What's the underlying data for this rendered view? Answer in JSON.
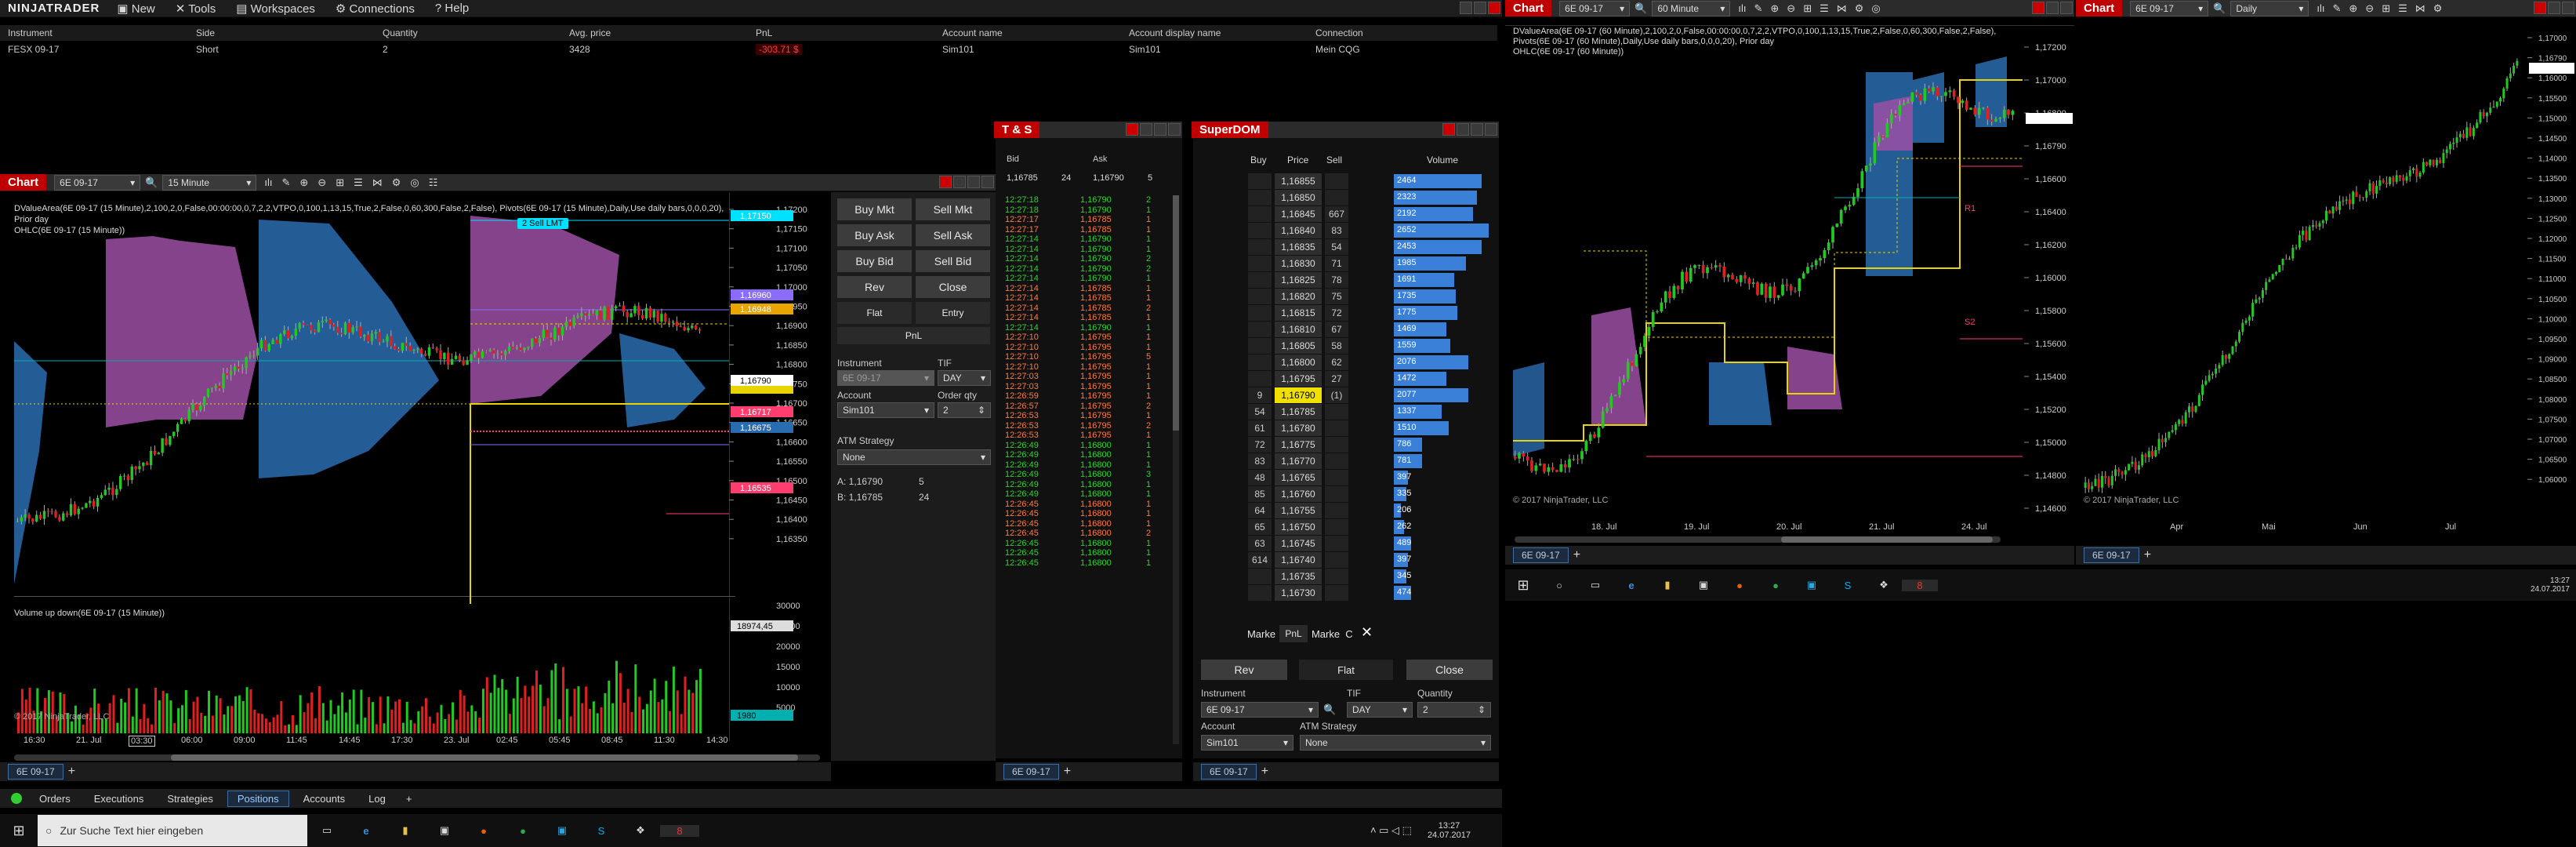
{
  "app": {
    "logo": "NINJATRADER",
    "menu": [
      "New",
      "Tools",
      "Workspaces",
      "Connections",
      "Help"
    ]
  },
  "positions": {
    "headers": [
      "Instrument",
      "Side",
      "Quantity",
      "Avg. price",
      "PnL",
      "Account name",
      "Account display name",
      "Connection"
    ],
    "row": [
      "FESX 09-17",
      "Short",
      "2",
      "3428",
      "-303.71 $",
      "Sim101",
      "Sim101",
      "Mein CQG"
    ]
  },
  "chart1": {
    "title": "Chart",
    "instrument": "6E 09-17",
    "interval": "15 Minute",
    "desc1": "DValueArea(6E 09-17 (15 Minute),2,100,2,0,False,00:00:00,0,7,2,2,VTPO,0,100,1,13,15,True,2,False,0,60,300,False,2,False), Pivots(6E 09-17 (15 Minute),Daily,Use daily bars,0,0,0,20), Prior day",
    "desc2": "OHLC(6E 09-17 (15 Minute))",
    "order_label": "2 Sell LMT",
    "price_tags": [
      "1,17150",
      "1,16960",
      "1,16948",
      "1,16790",
      "1,16717",
      "1,16675",
      "1,16535"
    ],
    "ticks": [
      "1,17200",
      "1,17150",
      "1,17100",
      "1,17050",
      "1,17000",
      "1,16950",
      "1,16900",
      "1,16850",
      "1,16800",
      "1,16750",
      "1,16700",
      "1,16650",
      "1,16600",
      "1,16550",
      "1,16500",
      "1,16450",
      "1,16400",
      "1,16350"
    ],
    "volume_title": "Volume up down(6E 09-17 (15 Minute))",
    "vol_ticks": [
      "30000",
      "25000",
      "20000",
      "15000",
      "10000",
      "5000"
    ],
    "vol_tags": [
      "18974,45",
      "1980"
    ],
    "copyright": "© 2017 NinjaTrader, LLC",
    "x_labels": [
      "16:30",
      "21. Jul",
      "03:30",
      "06:00",
      "09:00",
      "11:45",
      "14:45",
      "17:30",
      "23. Jul",
      "02:45",
      "05:45",
      "08:45",
      "11:30",
      "14:30"
    ],
    "tab": "6E 09-17"
  },
  "order_panel": {
    "buy_mkt": "Buy Mkt",
    "sell_mkt": "Sell Mkt",
    "buy_ask": "Buy Ask",
    "sell_ask": "Sell Ask",
    "buy_bid": "Buy Bid",
    "sell_bid": "Sell Bid",
    "rev": "Rev",
    "close": "Close",
    "flat": "Flat",
    "entry": "Entry",
    "pnl": "PnL",
    "instrument_label": "Instrument",
    "instrument": "6E 09-17",
    "tif_label": "TIF",
    "tif": "DAY",
    "account_label": "Account",
    "account": "Sim101",
    "qty_label": "Order qty",
    "qty": "2",
    "atm_label": "ATM Strategy",
    "atm": "None",
    "ask_line": "A: 1,16790",
    "ask_size": "5",
    "bid_line": "B: 1,16785",
    "bid_size": "24"
  },
  "ts": {
    "title": "T & S",
    "bid_label": "Bid",
    "ask_label": "Ask",
    "bid": "1,16785",
    "bid_size": "24",
    "ask": "1,16790",
    "ask_size": "5",
    "tab": "6E 09-17",
    "rows": [
      [
        "12:27:18",
        "1,16790",
        "2",
        "g"
      ],
      [
        "12:27:18",
        "1,16790",
        "1",
        "g"
      ],
      [
        "12:27:17",
        "1,16785",
        "1",
        "o"
      ],
      [
        "12:27:17",
        "1,16785",
        "1",
        "o"
      ],
      [
        "12:27:14",
        "1,16790",
        "1",
        "g"
      ],
      [
        "12:27:14",
        "1,16790",
        "1",
        "g"
      ],
      [
        "12:27:14",
        "1,16790",
        "2",
        "g"
      ],
      [
        "12:27:14",
        "1,16790",
        "2",
        "g"
      ],
      [
        "12:27:14",
        "1,16790",
        "1",
        "g"
      ],
      [
        "12:27:14",
        "1,16785",
        "1",
        "o"
      ],
      [
        "12:27:14",
        "1,16785",
        "1",
        "o"
      ],
      [
        "12:27:14",
        "1,16785",
        "2",
        "o"
      ],
      [
        "12:27:14",
        "1,16785",
        "1",
        "o"
      ],
      [
        "12:27:14",
        "1,16790",
        "1",
        "g"
      ],
      [
        "12:27:10",
        "1,16795",
        "1",
        "o"
      ],
      [
        "12:27:10",
        "1,16795",
        "1",
        "o"
      ],
      [
        "12:27:10",
        "1,16795",
        "5",
        "o"
      ],
      [
        "12:27:10",
        "1,16795",
        "1",
        "o"
      ],
      [
        "12:27:03",
        "1,16795",
        "1",
        "o"
      ],
      [
        "12:27:03",
        "1,16795",
        "1",
        "o"
      ],
      [
        "12:26:59",
        "1,16795",
        "1",
        "o"
      ],
      [
        "12:26:57",
        "1,16795",
        "2",
        "o"
      ],
      [
        "12:26:53",
        "1,16795",
        "1",
        "o"
      ],
      [
        "12:26:53",
        "1,16795",
        "2",
        "o"
      ],
      [
        "12:26:53",
        "1,16795",
        "1",
        "o"
      ],
      [
        "12:26:49",
        "1,16800",
        "1",
        "g"
      ],
      [
        "12:26:49",
        "1,16800",
        "1",
        "g"
      ],
      [
        "12:26:49",
        "1,16800",
        "1",
        "g"
      ],
      [
        "12:26:49",
        "1,16800",
        "3",
        "g"
      ],
      [
        "12:26:49",
        "1,16800",
        "1",
        "g"
      ],
      [
        "12:26:49",
        "1,16800",
        "1",
        "g"
      ],
      [
        "12:26:45",
        "1,16800",
        "1",
        "o"
      ],
      [
        "12:26:45",
        "1,16800",
        "1",
        "o"
      ],
      [
        "12:26:45",
        "1,16800",
        "1",
        "o"
      ],
      [
        "12:26:45",
        "1,16800",
        "2",
        "o"
      ],
      [
        "12:26:45",
        "1,16800",
        "1",
        "g"
      ],
      [
        "12:26:45",
        "1,16800",
        "1",
        "g"
      ],
      [
        "12:26:45",
        "1,16800",
        "1",
        "g"
      ]
    ]
  },
  "dom": {
    "title": "SuperDOM",
    "cols": [
      "Buy",
      "Price",
      "Sell",
      "Volume"
    ],
    "rows": [
      [
        "",
        "1,16855",
        "",
        "2464"
      ],
      [
        "",
        "1,16850",
        "",
        "2323"
      ],
      [
        "",
        "1,16845",
        "667",
        "2192"
      ],
      [
        "",
        "1,16840",
        "83",
        "2652"
      ],
      [
        "",
        "1,16835",
        "54",
        "2453"
      ],
      [
        "",
        "1,16830",
        "71",
        "1985"
      ],
      [
        "",
        "1,16825",
        "78",
        "1691"
      ],
      [
        "",
        "1,16820",
        "75",
        "1735"
      ],
      [
        "",
        "1,16815",
        "72",
        "1775"
      ],
      [
        "",
        "1,16810",
        "67",
        "1469"
      ],
      [
        "",
        "1,16805",
        "58",
        "1559"
      ],
      [
        "",
        "1,16800",
        "62",
        "2076"
      ],
      [
        "",
        "1,16795",
        "27",
        "1472"
      ],
      [
        "9",
        "1,16790",
        "(1)",
        "2077"
      ],
      [
        "54",
        "1,16785",
        "",
        "1337"
      ],
      [
        "61",
        "1,16780",
        "",
        "1510"
      ],
      [
        "72",
        "1,16775",
        "",
        "786"
      ],
      [
        "83",
        "1,16770",
        "",
        "781"
      ],
      [
        "48",
        "1,16765",
        "",
        "397"
      ],
      [
        "85",
        "1,16760",
        "",
        "335"
      ],
      [
        "64",
        "1,16755",
        "",
        "206"
      ],
      [
        "65",
        "1,16750",
        "",
        "262"
      ],
      [
        "63",
        "1,16745",
        "",
        "489"
      ],
      [
        "614",
        "1,16740",
        "",
        "397"
      ],
      [
        "",
        "1,16735",
        "",
        "345"
      ],
      [
        "",
        "1,16730",
        "",
        "474"
      ]
    ],
    "vol_frac": [
      0.62,
      0.59,
      0.56,
      0.67,
      0.62,
      0.51,
      0.43,
      0.44,
      0.45,
      0.37,
      0.4,
      0.53,
      0.37,
      0.53,
      0.34,
      0.39,
      0.2,
      0.2,
      0.1,
      0.09,
      0.05,
      0.07,
      0.12,
      0.1,
      0.09,
      0.12
    ],
    "mkt_left": "Marke",
    "pnl": "PnL",
    "mkt_right": "Marke",
    "c": "C",
    "rev": "Rev",
    "flat": "Flat",
    "close": "Close",
    "instrument_label": "Instrument",
    "instrument": "6E 09-17",
    "tif_label": "TIF",
    "tif": "DAY",
    "qty_label": "Quantity",
    "qty": "2",
    "account_label": "Account",
    "account": "Sim101",
    "atm_label": "ATM Strategy",
    "atm": "None",
    "tab": "6E 09-17"
  },
  "chart2": {
    "title": "Chart",
    "instrument": "6E 09-17",
    "interval": "60 Minute",
    "desc1": "DValueArea(6E 09-17 (60 Minute),2,100,2,0,False,00:00:00,0,7,2,2,VTPO,0,100,1,13,15,True,2,False,0,60,300,False,2,False), Pivots(6E 09-17 (60 Minute),Daily,Use daily bars,0,0,0,20), Prior day",
    "desc2": "OHLC(6E 09-17 (60 Minute))",
    "ticks": [
      "1,17200",
      "1,17000",
      "1,16800",
      "1,16790",
      "1,16600",
      "1,16400",
      "1,16200",
      "1,16000",
      "1,15800",
      "1,15600",
      "1,15400",
      "1,15200",
      "1,15000",
      "1,14800",
      "1,14600"
    ],
    "x_labels": [
      "18. Jul",
      "19. Jul",
      "20. Jul",
      "21. Jul",
      "24. Jul"
    ],
    "copyright": "© 2017 NinjaTrader, LLC",
    "tab": "6E 09-17",
    "pivots": [
      "R1",
      "S1",
      "S2"
    ]
  },
  "chart3": {
    "title": "Chart",
    "instrument": "6E 09-17",
    "interval": "Daily",
    "ticks": [
      "1,17000",
      "1,16790",
      "1,16000",
      "1,15500",
      "1,15000",
      "1,14500",
      "1,14000",
      "1,13500",
      "1,13000",
      "1,12500",
      "1,12000",
      "1,11500",
      "1,11000",
      "1,10500",
      "1,10000",
      "1,09500",
      "1,09000",
      "1,08500",
      "1,08000",
      "1,07500",
      "1,07000",
      "1,06500",
      "1,06000"
    ],
    "x_labels": [
      "Apr",
      "Mai",
      "Jun",
      "Jul"
    ],
    "copyright": "© 2017 NinjaTrader, LLC",
    "tab": "6E 09-17"
  },
  "ctrl_tabs": [
    "Orders",
    "Executions",
    "Strategies",
    "Positions",
    "Accounts",
    "Log"
  ],
  "taskbar_left": {
    "search": "Zur Suche Text hier eingeben",
    "time": "13:27",
    "date": "24.07.2017"
  },
  "taskbar_right": {
    "time": "13:27",
    "date": "24.07.2017"
  }
}
